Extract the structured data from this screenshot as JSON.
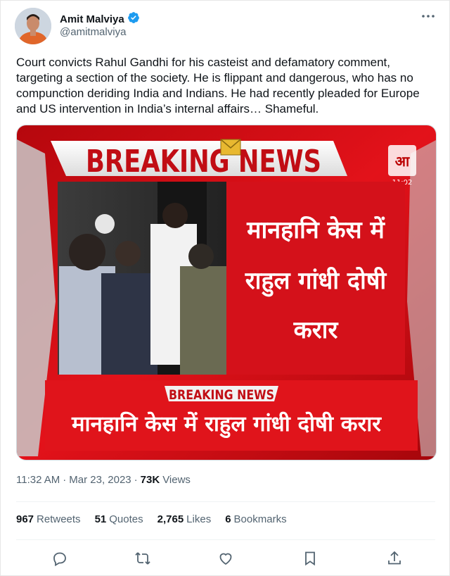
{
  "author": {
    "name": "Amit Malviya",
    "handle": "@amitmalviya",
    "verified": true,
    "verified_color": "#1d9bf0"
  },
  "tweet": {
    "text": "Court convicts Rahul Gandhi for his casteist and defamatory comment, targeting a section of the society. He is flippant and dangerous, who has no compunction deriding India and Indians. He had recently pleaded for Europe and US intervention in India’s internal affairs… Shameful."
  },
  "media": {
    "top_banner": "BREAKING NEWS",
    "headline_lines": [
      "मानहानि केस में",
      "राहुल गांधी दोषी",
      "करार"
    ],
    "lower_banner": "BREAKING NEWS",
    "ticker": "मानहानि केस में राहुल गांधी दोषी करार",
    "clock": "11:02",
    "accent_red": "#d9141b"
  },
  "meta": {
    "time": "11:32 AM",
    "dot": "·",
    "date": "Mar 23, 2023",
    "views_count": "73K",
    "views_label": "Views"
  },
  "stats": {
    "retweets_count": "967",
    "retweets_label": "Retweets",
    "quotes_count": "51",
    "quotes_label": "Quotes",
    "likes_count": "2,765",
    "likes_label": "Likes",
    "bookmarks_count": "6",
    "bookmarks_label": "Bookmarks"
  },
  "actions": [
    "reply-icon",
    "retweet-icon",
    "like-icon",
    "bookmark-icon",
    "share-icon"
  ]
}
